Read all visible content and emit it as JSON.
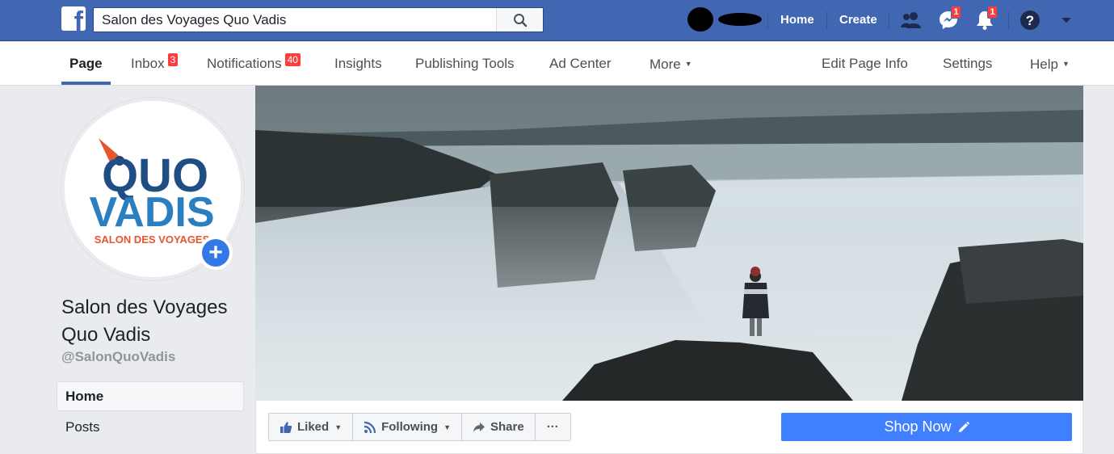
{
  "topbar": {
    "search_value": "Salon des Voyages Quo Vadis",
    "home_label": "Home",
    "create_label": "Create",
    "messenger_badge": "1",
    "notifications_badge": "1",
    "brand_color": "#4267b2"
  },
  "pagenav": {
    "page_label": "Page",
    "inbox_label": "Inbox",
    "inbox_badge": "3",
    "notifications_label": "Notifications",
    "notifications_badge": "40",
    "insights_label": "Insights",
    "publishing_label": "Publishing Tools",
    "adcenter_label": "Ad Center",
    "more_label": "More",
    "edit_label": "Edit Page Info",
    "settings_label": "Settings",
    "help_label": "Help"
  },
  "profile": {
    "logo_line1": "QUO",
    "logo_line2": "VADIS",
    "logo_tagline": "SALON DES VOYAGES",
    "name_line1": "Salon des Voyages",
    "name_line2": "Quo Vadis",
    "handle": "@SalonQuoVadis"
  },
  "sidebar": {
    "items": [
      {
        "label": "Home"
      },
      {
        "label": "Posts"
      }
    ]
  },
  "actions": {
    "liked_label": "Liked",
    "following_label": "Following",
    "share_label": "Share",
    "more_label": "···",
    "shop_label": "Shop Now"
  }
}
